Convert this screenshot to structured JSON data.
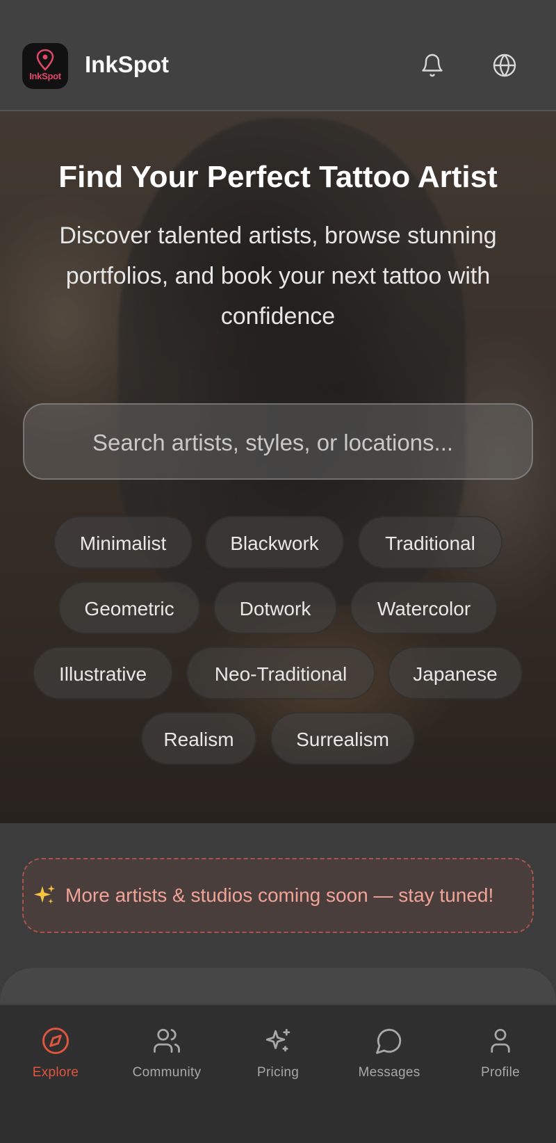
{
  "header": {
    "logo_text": "InkSpot",
    "app_title": "InkSpot",
    "icons": [
      "bell-icon",
      "globe-icon"
    ]
  },
  "hero": {
    "title": "Find Your Perfect Tattoo Artist",
    "subtitle": "Discover talented artists, browse stunning portfolios, and book your next tattoo with confidence",
    "search_placeholder": "Search artists, styles, or locations...",
    "styles": [
      "Minimalist",
      "Blackwork",
      "Traditional",
      "Geometric",
      "Dotwork",
      "Watercolor",
      "Illustrative",
      "Neo-Traditional",
      "Japanese",
      "Realism",
      "Surrealism"
    ]
  },
  "banner": {
    "icon": "sparkles-icon",
    "text": "More artists & studios coming soon — stay tuned!"
  },
  "tabbar": {
    "items": [
      {
        "label": "Explore",
        "icon": "compass-icon",
        "active": true
      },
      {
        "label": "Community",
        "icon": "users-icon"
      },
      {
        "label": "Pricing",
        "icon": "sparkles-icon"
      },
      {
        "label": "Messages",
        "icon": "chat-bubble-icon"
      },
      {
        "label": "Profile",
        "icon": "user-icon"
      }
    ]
  },
  "colors": {
    "accent": "#e0553f",
    "logo_pink": "#e2476a",
    "banner_text": "#f0a396"
  }
}
